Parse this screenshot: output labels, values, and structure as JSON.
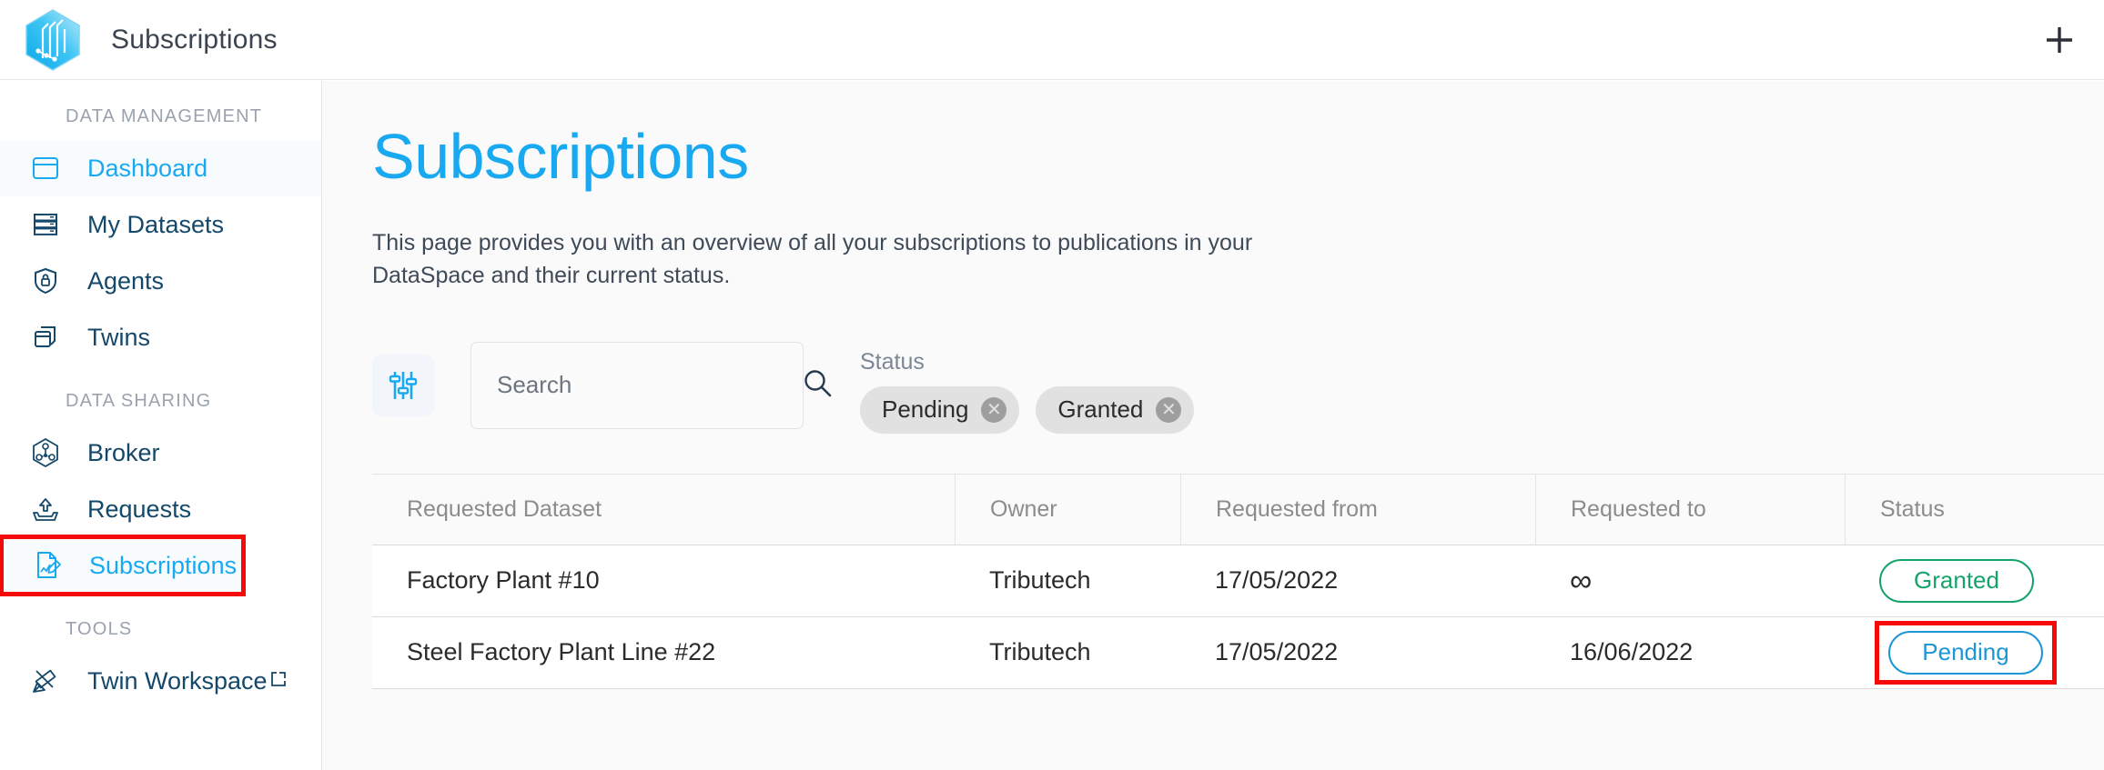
{
  "topbar": {
    "title": "Subscriptions",
    "logo_icon": "tributech-hexagon-logo",
    "add_icon": "plus-icon",
    "add_label": "+"
  },
  "sidebar": {
    "groups": [
      {
        "label": "DATA MANAGEMENT",
        "items": [
          {
            "label": "Dashboard",
            "icon": "dashboard-icon",
            "state": "active"
          },
          {
            "label": "My Datasets",
            "icon": "datasets-icon",
            "state": "normal"
          },
          {
            "label": "Agents",
            "icon": "shield-lock-icon",
            "state": "normal"
          },
          {
            "label": "Twins",
            "icon": "twins-copy-icon",
            "state": "normal"
          }
        ]
      },
      {
        "label": "DATA SHARING",
        "items": [
          {
            "label": "Broker",
            "icon": "broker-network-icon",
            "state": "normal"
          },
          {
            "label": "Requests",
            "icon": "requests-upload-icon",
            "state": "normal"
          },
          {
            "label": "Subscriptions",
            "icon": "subscriptions-doc-icon",
            "state": "selected-highlighted"
          }
        ]
      },
      {
        "label": "TOOLS",
        "items": [
          {
            "label": "Twin Workspace",
            "icon": "tools-brush-icon",
            "state": "normal",
            "external": true
          }
        ]
      }
    ]
  },
  "main": {
    "page_title": "Subscriptions",
    "page_description": "This page provides you with an overview of all your subscriptions to publications in your DataSpace and their current status.",
    "filters": {
      "toggle_icon": "filter-sliders-icon",
      "search": {
        "placeholder": "Search",
        "value": "",
        "icon": "search-icon"
      },
      "status_label": "Status",
      "chips": [
        {
          "label": "Pending",
          "remove_icon": "close-circle-icon",
          "remove_label": "✕"
        },
        {
          "label": "Granted",
          "remove_icon": "close-circle-icon",
          "remove_label": "✕"
        }
      ]
    },
    "table": {
      "columns": [
        "Requested Dataset",
        "Owner",
        "Requested from",
        "Requested to",
        "Status"
      ],
      "rows": [
        {
          "dataset": "Factory Plant #10",
          "owner": "Tributech",
          "requested_from": "17/05/2022",
          "requested_to": "∞",
          "status": "Granted",
          "status_kind": "granted",
          "status_highlighted": false
        },
        {
          "dataset": "Steel Factory Plant Line #22",
          "owner": "Tributech",
          "requested_from": "17/05/2022",
          "requested_to": "16/06/2022",
          "status": "Pending",
          "status_kind": "pending",
          "status_highlighted": true
        }
      ]
    }
  },
  "colors": {
    "accent_blue": "#19a9f0",
    "nav_text": "#14486b",
    "granted_green": "#16a36a",
    "pending_blue": "#1c96d4",
    "highlight_red": "#f50a0a",
    "muted_gray": "#9aa2ad"
  }
}
